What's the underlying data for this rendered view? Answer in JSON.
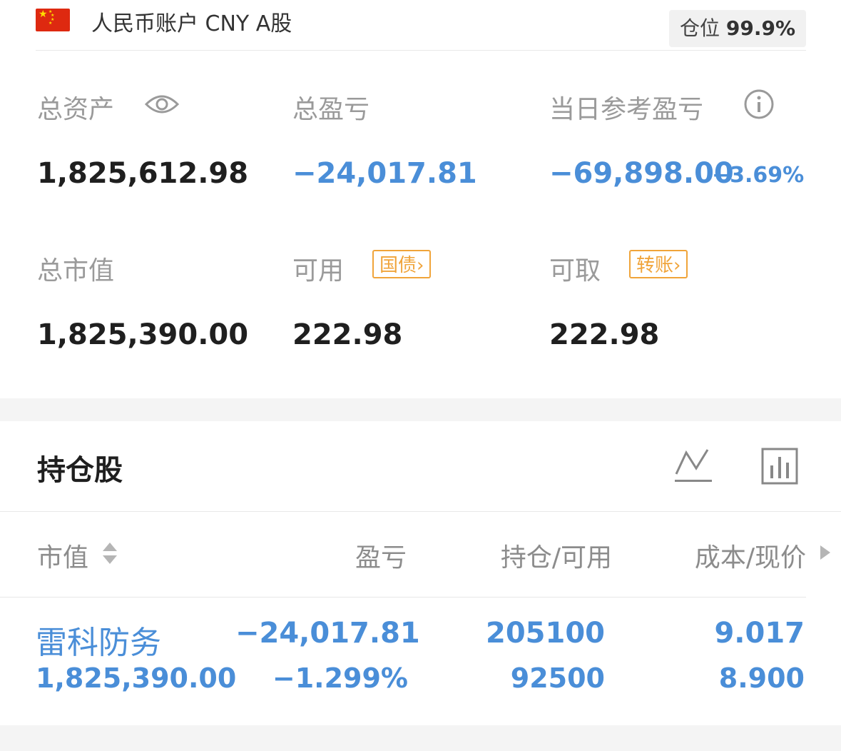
{
  "account": {
    "title": "人民币账户 CNY A股",
    "position_label": "仓位",
    "position_value": "99.9%"
  },
  "summary": {
    "total_assets_label": "总资产",
    "total_assets_value": "1,825,612.98",
    "total_pnl_label": "总盈亏",
    "total_pnl_value": "−24,017.81",
    "daily_pnl_label": "当日参考盈亏",
    "daily_pnl_value": "−69,898.00",
    "daily_pnl_pct": "−3.69%",
    "market_value_label": "总市值",
    "market_value_value": "1,825,390.00",
    "available_label": "可用",
    "available_value": "222.98",
    "treasury_label": "国债",
    "withdrawable_label": "可取",
    "withdrawable_value": "222.98",
    "transfer_label": "转账"
  },
  "holdings": {
    "title": "持仓股",
    "columns": [
      "市值",
      "盈亏",
      "持仓/可用",
      "成本/现价"
    ],
    "rows": [
      {
        "name": "雷科防务",
        "market_value": "1,825,390.00",
        "pnl": "−24,017.81",
        "pnl_pct": "−1.299%",
        "position": "205100",
        "available": "92500",
        "cost": "9.017",
        "price": "8.900"
      }
    ]
  },
  "colors": {
    "accent_blue": "#4a8ed8",
    "tag_orange": "#f0a43a",
    "label_gray": "#9a9a9a"
  },
  "icons": [
    "china-flag-icon",
    "eye-icon",
    "info-icon",
    "line-chart-icon",
    "bar-chart-icon",
    "sort-icon",
    "chevron-right-icon"
  ]
}
